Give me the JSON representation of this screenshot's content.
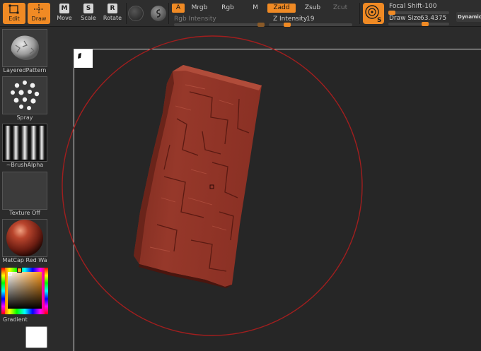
{
  "toolbar": {
    "edit_label": "Edit",
    "draw_label": "Draw",
    "move_label": "Move",
    "move_key": "M",
    "scale_label": "Scale",
    "scale_key": "S",
    "rotate_label": "Rotate",
    "rotate_key": "R",
    "a_label": "A",
    "mrgb_label": "Mrgb",
    "rgb_label": "Rgb",
    "m_label": "M",
    "rgb_intensity_label": "Rgb Intensity",
    "zadd_label": "Zadd",
    "zsub_label": "Zsub",
    "zcut_label": "Zcut",
    "z_intensity_label": "Z Intensity",
    "z_intensity_value": "19",
    "z_intensity_fraction": 0.19,
    "rgb_intensity_fraction": 1.0,
    "focal_shift_label": "Focal Shift",
    "focal_shift_value": "-100",
    "focal_shift_fraction": 0.0,
    "draw_size_label": "Draw Size",
    "draw_size_value": "63.4375",
    "draw_size_fraction": 0.62,
    "dynamic_label": "Dynamic"
  },
  "sidebar": {
    "brush_label": "LayeredPattern",
    "stroke_label": "Spray",
    "alpha_label": "~BrushAlpha",
    "texture_label": "Texture Off",
    "material_label": "MatCap Red Wa",
    "gradient_label": "Gradient"
  },
  "colors": {
    "accent": "#f08a24",
    "mesh": "#8f3326",
    "brush_ring": "#a11e1e",
    "main_color": "#ffffff"
  }
}
